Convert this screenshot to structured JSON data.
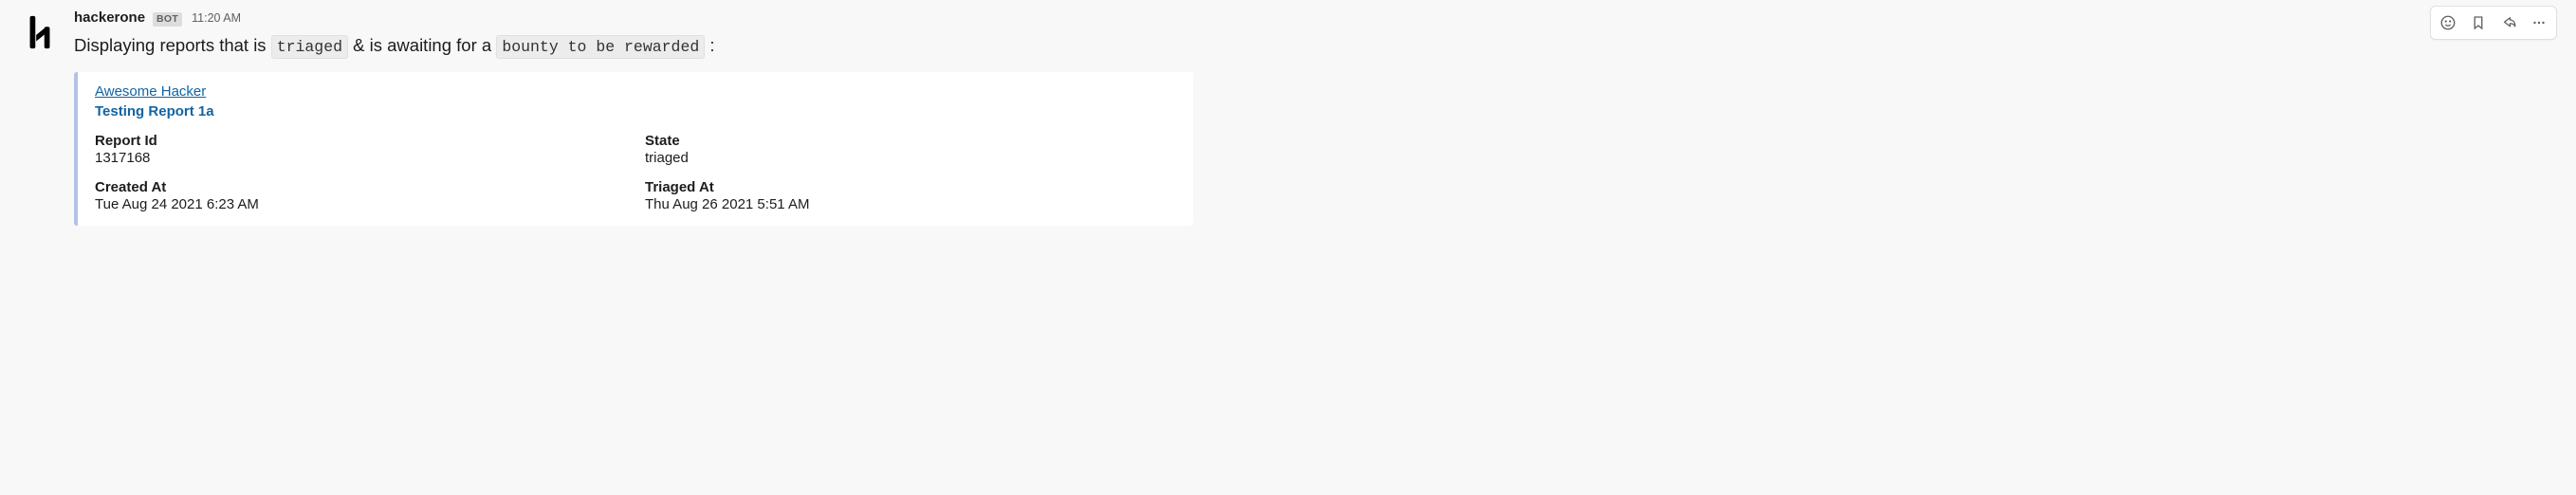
{
  "message": {
    "sender": "hackerone",
    "bot_label": "BOT",
    "time": "11:20 AM",
    "text_prefix": "Displaying reports that is ",
    "code1": "triaged",
    "text_mid": " & is awaiting for a ",
    "code2": "bounty to be rewarded",
    "text_suffix": " :"
  },
  "attachment": {
    "author": "Awesome Hacker",
    "title": "Testing Report 1a",
    "fields": {
      "report_id": {
        "label": "Report Id",
        "value": "1317168"
      },
      "state": {
        "label": "State",
        "value": "triaged"
      },
      "created_at": {
        "label": "Created At",
        "value": "Tue Aug 24 2021 6:23 AM"
      },
      "triaged_at": {
        "label": "Triaged At",
        "value": "Thu Aug 26 2021 5:51 AM"
      }
    }
  },
  "actions": {
    "emoji": "Add reaction",
    "bookmark": "Bookmark",
    "share": "Share message",
    "more": "More actions"
  }
}
